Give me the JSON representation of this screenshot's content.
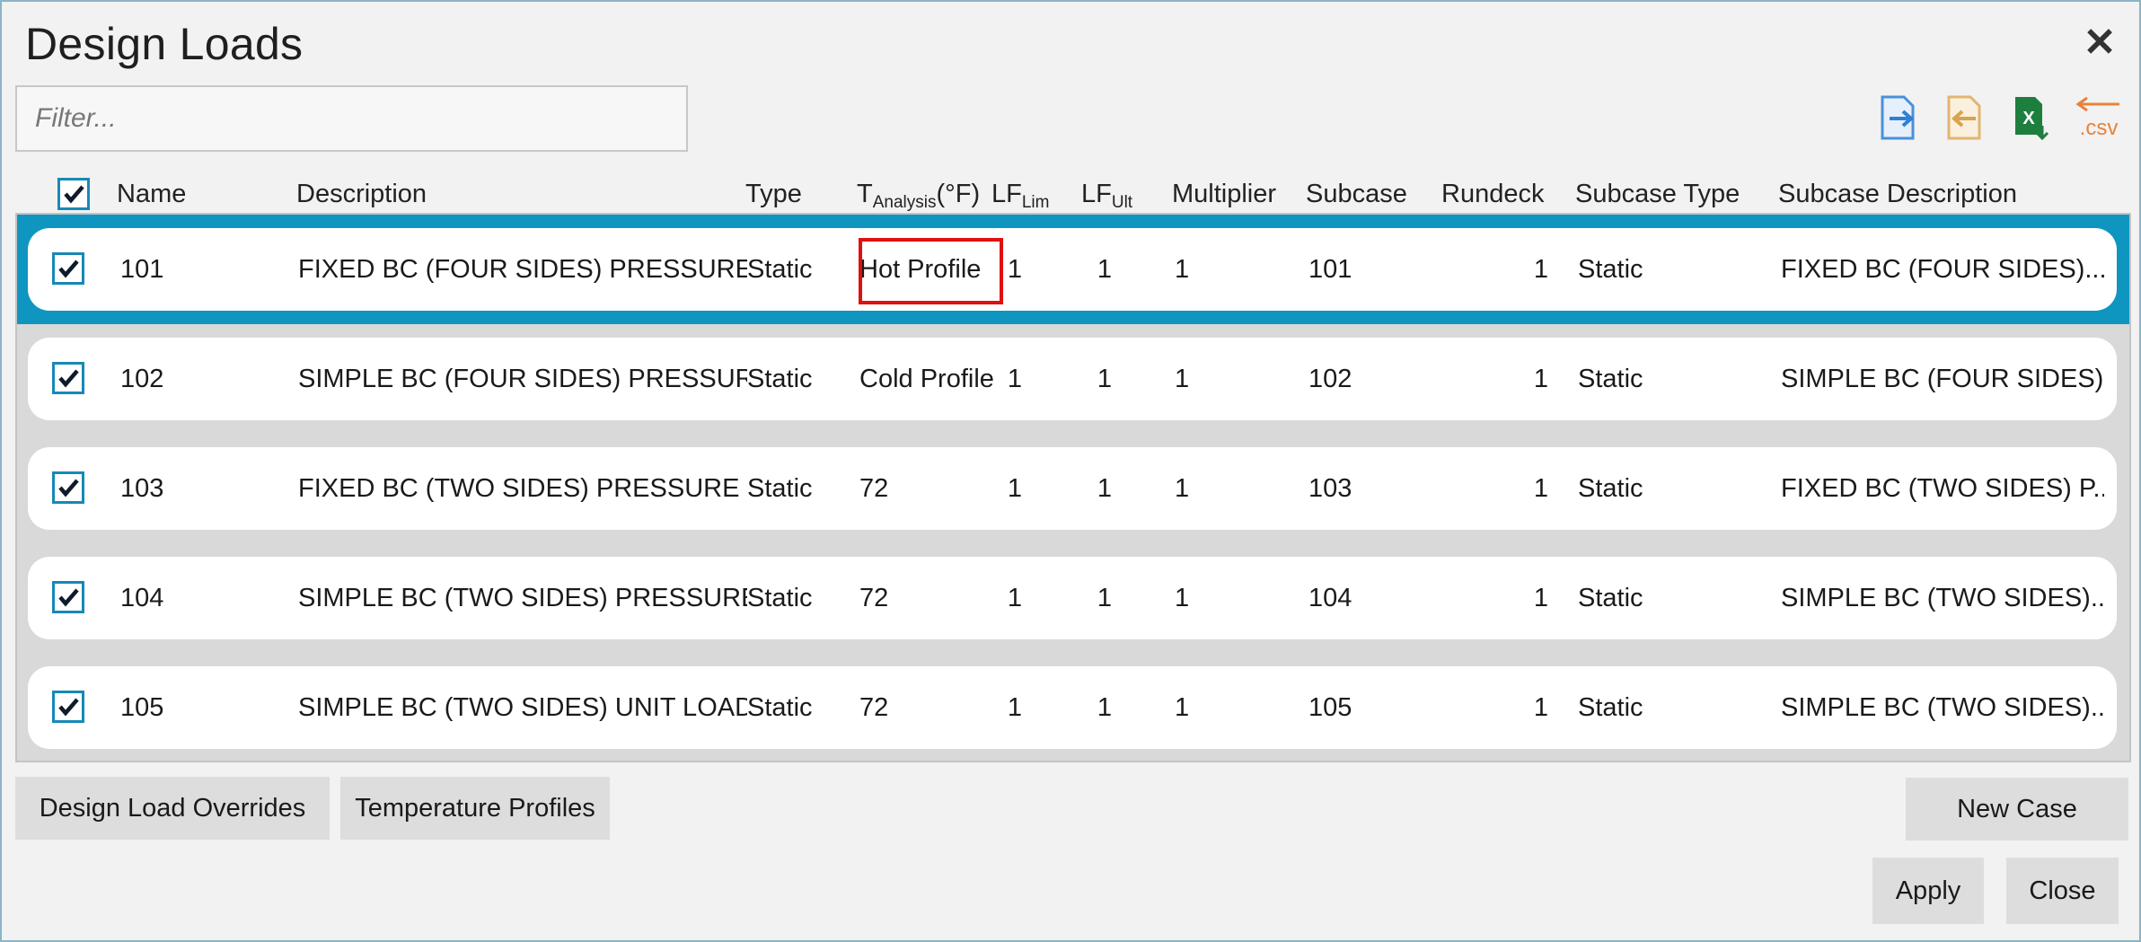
{
  "dialog": {
    "title": "Design Loads",
    "close_glyph": "✕"
  },
  "filter": {
    "placeholder": "Filter...",
    "value": ""
  },
  "toolbar": {
    "icons": [
      "export-icon",
      "import-icon",
      "excel-export-icon",
      "csv-import-icon"
    ],
    "csv_label": ".csv",
    "excel_letter": "X"
  },
  "columns": {
    "name": "Name",
    "description": "Description",
    "type": "Type",
    "t_analysis_main": "T",
    "t_analysis_sub": "Analysis",
    "t_analysis_unit": "(°F)",
    "lf_lim_main": "LF",
    "lf_lim_sub": "Lim",
    "lf_ult_main": "LF",
    "lf_ult_sub": "Ult",
    "multiplier": "Multiplier",
    "subcase": "Subcase",
    "rundeck": "Rundeck",
    "subcase_type": "Subcase Type",
    "subcase_description": "Subcase Description"
  },
  "rows": [
    {
      "checked": true,
      "name": "101",
      "description": "FIXED BC (FOUR SIDES) PRESSURE",
      "type": "Static",
      "t_analysis": "Hot Profile",
      "lf_lim": "1",
      "lf_ult": "1",
      "multiplier": "1",
      "subcase": "101",
      "rundeck": "1",
      "subcase_type": "Static",
      "subcase_description": "FIXED BC (FOUR SIDES)..."
    },
    {
      "checked": true,
      "name": "102",
      "description": "SIMPLE BC (FOUR SIDES) PRESSURE",
      "type": "Static",
      "t_analysis": "Cold Profile",
      "lf_lim": "1",
      "lf_ult": "1",
      "multiplier": "1",
      "subcase": "102",
      "rundeck": "1",
      "subcase_type": "Static",
      "subcase_description": "SIMPLE BC (FOUR SIDES)..."
    },
    {
      "checked": true,
      "name": "103",
      "description": "FIXED BC (TWO SIDES) PRESSURE",
      "type": "Static",
      "t_analysis": "72",
      "lf_lim": "1",
      "lf_ult": "1",
      "multiplier": "1",
      "subcase": "103",
      "rundeck": "1",
      "subcase_type": "Static",
      "subcase_description": "FIXED BC (TWO SIDES) P..."
    },
    {
      "checked": true,
      "name": "104",
      "description": "SIMPLE BC (TWO SIDES) PRESSURE",
      "type": "Static",
      "t_analysis": "72",
      "lf_lim": "1",
      "lf_ult": "1",
      "multiplier": "1",
      "subcase": "104",
      "rundeck": "1",
      "subcase_type": "Static",
      "subcase_description": "SIMPLE BC (TWO SIDES)..."
    },
    {
      "checked": true,
      "name": "105",
      "description": "SIMPLE BC (TWO SIDES) UNIT LOAD",
      "type": "Static",
      "t_analysis": "72",
      "lf_lim": "1",
      "lf_ult": "1",
      "multiplier": "1",
      "subcase": "105",
      "rundeck": "1",
      "subcase_type": "Static",
      "subcase_description": "SIMPLE BC (TWO SIDES)..."
    }
  ],
  "selected_row_index": 0,
  "buttons": {
    "design_load_overrides": "Design Load Overrides",
    "temperature_profiles": "Temperature Profiles",
    "new_case": "New Case",
    "apply": "Apply",
    "close": "Close"
  },
  "colors": {
    "selection": "#0e96c0",
    "checkbox": "#1789b7",
    "highlight_box": "#e01010"
  }
}
